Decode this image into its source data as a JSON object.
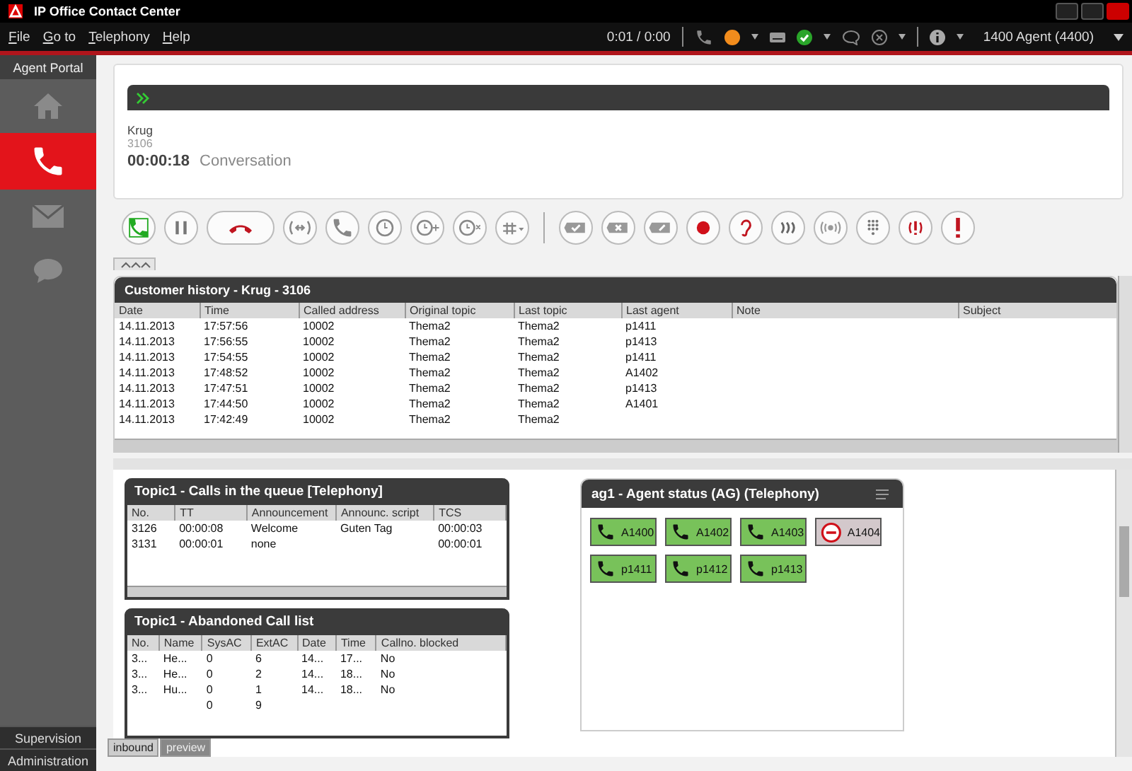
{
  "window": {
    "title": "IP Office Contact Center"
  },
  "menu": [
    "File",
    "Go to",
    "Telephony",
    "Help"
  ],
  "status_bar": {
    "timer": "0:01 /  0:00",
    "agent": "1400 Agent (4400)"
  },
  "sidebar": {
    "header": "Agent Portal",
    "items": [
      {
        "kind": "home",
        "selected": false
      },
      {
        "kind": "phone",
        "selected": true
      },
      {
        "kind": "mail",
        "selected": false
      },
      {
        "kind": "chat",
        "selected": false
      }
    ],
    "footer": [
      "Supervision",
      "Administration"
    ]
  },
  "call": {
    "name": "Krug",
    "number": "3106",
    "duration": "00:00:18",
    "state": "Conversation"
  },
  "history": {
    "title": "Customer history - Krug - 3106",
    "columns": [
      "Date",
      "Time",
      "Called address",
      "Original topic",
      "Last topic",
      "Last agent",
      "Note",
      "Subject"
    ],
    "rows": [
      [
        "14.11.2013",
        "17:57:56",
        "10002",
        "Thema2",
        "Thema2",
        "p1411",
        "",
        ""
      ],
      [
        "14.11.2013",
        "17:56:55",
        "10002",
        "Thema2",
        "Thema2",
        "p1413",
        "",
        ""
      ],
      [
        "14.11.2013",
        "17:54:55",
        "10002",
        "Thema2",
        "Thema2",
        "p1411",
        "",
        ""
      ],
      [
        "14.11.2013",
        "17:48:52",
        "10002",
        "Thema2",
        "Thema2",
        "A1402",
        "",
        ""
      ],
      [
        "14.11.2013",
        "17:47:51",
        "10002",
        "Thema2",
        "Thema2",
        "p1413",
        "",
        ""
      ],
      [
        "14.11.2013",
        "17:44:50",
        "10002",
        "Thema2",
        "Thema2",
        "A1401",
        "",
        ""
      ],
      [
        "14.11.2013",
        "17:42:49",
        "10002",
        "Thema2",
        "Thema2",
        "",
        "",
        ""
      ]
    ]
  },
  "queue": {
    "title": "Topic1 - Calls in the queue [Telephony]",
    "columns": [
      "No.",
      "TT",
      "Announcement",
      "Announc. script",
      "TCS"
    ],
    "rows": [
      [
        "3126",
        "00:00:08",
        "Welcome",
        "Guten Tag",
        "00:00:03"
      ],
      [
        "3131",
        "00:00:01",
        "none",
        "",
        "00:00:01"
      ]
    ]
  },
  "abandoned": {
    "title": "Topic1 - Abandoned Call list",
    "columns": [
      "No.",
      "Name",
      "SysAC",
      "ExtAC",
      "Date",
      "Time",
      "Callno. blocked"
    ],
    "rows": [
      [
        "3...",
        "He...",
        "0",
        "6",
        "14...",
        "17...",
        "No"
      ],
      [
        "3...",
        "He...",
        "0",
        "2",
        "14...",
        "18...",
        "No"
      ],
      [
        "3...",
        "Hu...",
        "0",
        "1",
        "14...",
        "18...",
        "No"
      ],
      [
        "",
        "",
        "0",
        "9",
        "",
        "",
        ""
      ]
    ]
  },
  "agents": {
    "title": "ag1 - Agent status (AG) (Telephony)",
    "items": [
      {
        "name": "A1400",
        "kind": "available"
      },
      {
        "name": "A1402",
        "kind": "available"
      },
      {
        "name": "A1403",
        "kind": "available"
      },
      {
        "name": "A1404",
        "kind": "unavailable"
      },
      {
        "name": "p1411",
        "kind": "available"
      },
      {
        "name": "p1412",
        "kind": "available"
      },
      {
        "name": "p1413",
        "kind": "available"
      }
    ]
  },
  "tabs": [
    {
      "label": "inbound",
      "selected": true
    },
    {
      "label": "preview",
      "selected": false
    }
  ]
}
